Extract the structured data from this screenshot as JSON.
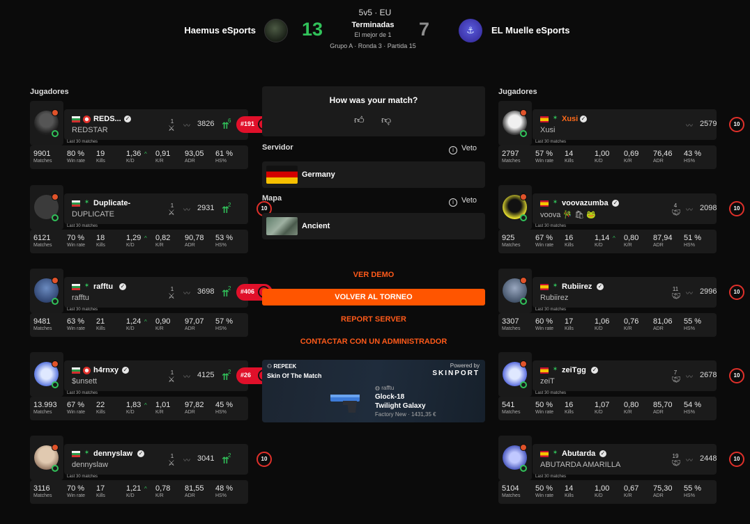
{
  "header": {
    "format": "5v5 · EU",
    "team_left": "Haemus eSports",
    "team_right": "EL Muelle eSports",
    "score_left": "13",
    "score_right": "7",
    "status": "Terminadas",
    "best_of": "El mejor de 1",
    "group_info": "Grupo A · Ronda 3 · Partida 15",
    "score_left_color": "#31c25a",
    "score_right_color": "#8e8e8e"
  },
  "left_title": "Jugadores",
  "right_title": "Jugadores",
  "stat_labels": {
    "last30": "Last 30 matches",
    "matches": "Matches",
    "winrate": "Win rate",
    "kills": "Kills",
    "kd": "K/D",
    "kr": "K/R",
    "adr": "ADR",
    "hs": "HS%"
  },
  "left_players": [
    {
      "name": "REDS...",
      "sub": "REDSTAR",
      "party": "1",
      "elo": "3826",
      "elo_change": "6",
      "rank": "#191",
      "matches": "9901",
      "winrate": "80 %",
      "kills": "19",
      "kd": "1,36",
      "kr": "0,91",
      "adr": "93,05",
      "hs": "61 %"
    },
    {
      "name": "Duplicate-",
      "sub": "DUPLICATE",
      "party": "1",
      "elo": "2931",
      "elo_change": "2",
      "level": "10",
      "matches": "6121",
      "winrate": "70 %",
      "kills": "18",
      "kd": "1,29",
      "kr": "0,82",
      "adr": "90,78",
      "hs": "53 %"
    },
    {
      "name": "rafftu",
      "sub": "rafftu",
      "party": "1",
      "elo": "3698",
      "elo_change": "2",
      "rank": "#406",
      "matches": "9481",
      "winrate": "63 %",
      "kills": "21",
      "kd": "1,24",
      "kr": "0,90",
      "adr": "97,07",
      "hs": "57 %"
    },
    {
      "name": "h4rnxy",
      "sub": "$unsett",
      "party": "1",
      "elo": "4125",
      "elo_change": "2",
      "rank": "#26",
      "matches": "13.993",
      "winrate": "67 %",
      "kills": "22",
      "kd": "1,83",
      "kr": "1,01",
      "adr": "97,82",
      "hs": "45 %"
    },
    {
      "name": "dennyslaw",
      "sub": "dennyslaw",
      "party": "1",
      "elo": "3041",
      "elo_change": "2",
      "level": "10",
      "matches": "3116",
      "winrate": "70 %",
      "kills": "17",
      "kd": "1,21",
      "kr": "0,78",
      "adr": "81,55",
      "hs": "48 %"
    }
  ],
  "right_players": [
    {
      "name": "Xusi",
      "sub": "Xusi",
      "party": "",
      "elo": "2579",
      "level": "10",
      "matches": "2797",
      "winrate": "57 %",
      "kills": "14",
      "kd": "1,00",
      "kr": "0,69",
      "adr": "76,46",
      "hs": "43 %"
    },
    {
      "name": "voovazumba",
      "sub": "voova 🎋 🛍 🐸",
      "party": "4",
      "elo": "2098",
      "level": "10",
      "matches": "925",
      "winrate": "67 %",
      "kills": "16",
      "kd": "1,14",
      "kr": "0,80",
      "adr": "87,94",
      "hs": "51 %"
    },
    {
      "name": "Rubiirez",
      "sub": "Rubiirez",
      "party": "11",
      "elo": "2996",
      "level": "10",
      "matches": "3307",
      "winrate": "60 %",
      "kills": "17",
      "kd": "1,06",
      "kr": "0,76",
      "adr": "81,06",
      "hs": "55 %"
    },
    {
      "name": "zeiTgg",
      "sub": "zeiT",
      "party": "7",
      "elo": "2678",
      "level": "10",
      "matches": "541",
      "winrate": "50 %",
      "kills": "16",
      "kd": "1,07",
      "kr": "0,80",
      "adr": "85,70",
      "hs": "54 %"
    },
    {
      "name": "Abutarda",
      "sub": "ABUTARDA AMARILLA",
      "party": "19",
      "elo": "2448",
      "level": "10",
      "matches": "5104",
      "winrate": "50 %",
      "kills": "14",
      "kd": "1,00",
      "kr": "0,67",
      "adr": "75,30",
      "hs": "55 %"
    }
  ],
  "middle": {
    "rate_title": "How was your match?",
    "server_title": "Servidor",
    "veto_label": "Veto",
    "server_value": "Germany",
    "map_title": "Mapa",
    "map_value": "Ancient",
    "ver_demo": "VER DEMO",
    "volver": "VOLVER AL TORNEO",
    "report": "REPORT SERVER",
    "contactar": "CONTACTAR CON UN ADMINISTRADOR",
    "accent": "#ff5500"
  },
  "skin": {
    "brand": "REPEEK",
    "title": "Skin Of The Match",
    "powered": "Powered by",
    "provider": "SKINPORT",
    "owner": "rafftu",
    "weapon": "Glock-18",
    "skin_name": "Twilight Galaxy",
    "price": "Factory New · 1431,35 €"
  }
}
